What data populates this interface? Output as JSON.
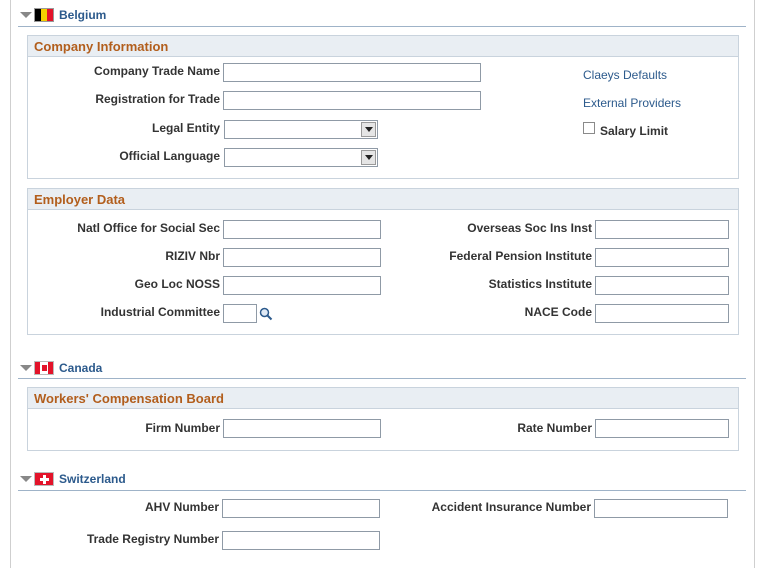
{
  "belgium": {
    "country": "Belgium",
    "company_info": {
      "title": "Company Information",
      "company_trade_name": {
        "label": "Company Trade Name",
        "value": ""
      },
      "registration_for_trade": {
        "label": "Registration for Trade",
        "value": ""
      },
      "legal_entity": {
        "label": "Legal Entity",
        "value": ""
      },
      "official_language": {
        "label": "Official Language",
        "value": ""
      },
      "claeys_defaults": "Claeys Defaults",
      "external_providers": "External Providers",
      "salary_limit": {
        "label": "Salary Limit",
        "checked": false
      }
    },
    "employer_data": {
      "title": "Employer Data",
      "natl_office": {
        "label": "Natl Office for Social Sec",
        "value": ""
      },
      "riziv_nbr": {
        "label": "RIZIV Nbr",
        "value": ""
      },
      "geo_loc_noss": {
        "label": "Geo Loc NOSS",
        "value": ""
      },
      "industrial_committee": {
        "label": "Industrial Committee",
        "value": ""
      },
      "overseas_soc_ins": {
        "label": "Overseas Soc Ins Inst",
        "value": ""
      },
      "federal_pension": {
        "label": "Federal Pension Institute",
        "value": ""
      },
      "statistics_institute": {
        "label": "Statistics Institute",
        "value": ""
      },
      "nace_code": {
        "label": "NACE Code",
        "value": ""
      }
    }
  },
  "canada": {
    "country": "Canada",
    "wcb": {
      "title": "Workers' Compensation Board",
      "firm_number": {
        "label": "Firm Number",
        "value": ""
      },
      "rate_number": {
        "label": "Rate Number",
        "value": ""
      }
    }
  },
  "switzerland": {
    "country": "Switzerland",
    "ahv_number": {
      "label": "AHV Number",
      "value": ""
    },
    "trade_registry_number": {
      "label": "Trade Registry Number",
      "value": ""
    },
    "accident_insurance_number": {
      "label": "Accident Insurance Number",
      "value": ""
    }
  },
  "colors": {
    "link": "#2c5a8c",
    "box_title": "#b25e1c",
    "box_header_bg": "#e9eef3"
  },
  "icons": {
    "expand": "triangle-down-icon",
    "lookup": "magnifier-icon"
  }
}
